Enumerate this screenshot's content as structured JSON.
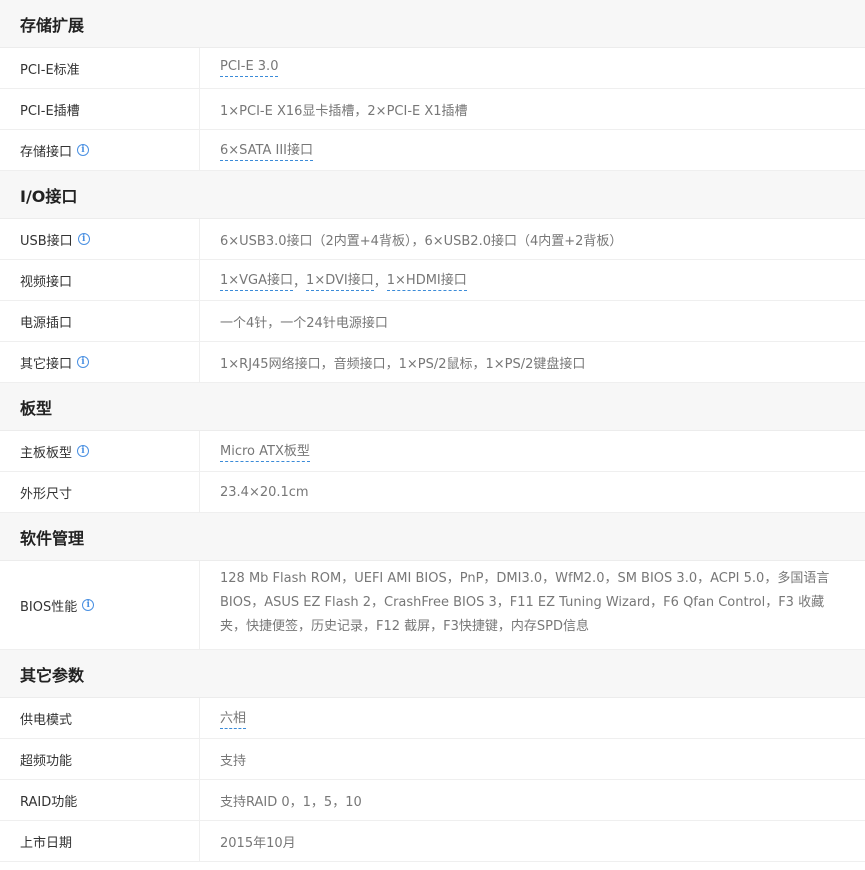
{
  "sections": [
    {
      "title": "存储扩展",
      "rows": [
        {
          "label": "PCI-E标准",
          "info": false,
          "links": [
            "PCI-E 3.0"
          ],
          "value": ""
        },
        {
          "label": "PCI-E插槽",
          "info": false,
          "value": "1×PCI-E X16显卡插槽，2×PCI-E X1插槽"
        },
        {
          "label": "存储接口",
          "info": true,
          "links": [
            "6×SATA III接口"
          ],
          "value": ""
        }
      ]
    },
    {
      "title": "I/O接口",
      "rows": [
        {
          "label": "USB接口",
          "info": true,
          "value": "6×USB3.0接口（2内置+4背板），6×USB2.0接口（4内置+2背板）"
        },
        {
          "label": "视频接口",
          "info": false,
          "links": [
            "1×VGA接口",
            "1×DVI接口",
            "1×HDMI接口"
          ],
          "value": ""
        },
        {
          "label": "电源插口",
          "info": false,
          "value": "一个4针，一个24针电源接口"
        },
        {
          "label": "其它接口",
          "info": true,
          "value": "1×RJ45网络接口，音频接口，1×PS/2鼠标，1×PS/2键盘接口"
        }
      ]
    },
    {
      "title": "板型",
      "rows": [
        {
          "label": "主板板型",
          "info": true,
          "links": [
            "Micro ATX板型"
          ],
          "value": ""
        },
        {
          "label": "外形尺寸",
          "info": false,
          "value": "23.4×20.1cm"
        }
      ]
    },
    {
      "title": "软件管理",
      "rows": [
        {
          "label": "BIOS性能",
          "info": true,
          "multi": true,
          "value": "128 Mb Flash ROM，UEFI AMI BIOS，PnP，DMI3.0，WfM2.0，SM BIOS 3.0，ACPI 5.0，多国语言BIOS，ASUS EZ Flash 2，CrashFree BIOS 3，F11 EZ Tuning Wizard，F6 Qfan Control，F3 收藏夹，快捷便签，历史记录，F12 截屏，F3快捷键，内存SPD信息"
        }
      ]
    },
    {
      "title": "其它参数",
      "rows": [
        {
          "label": "供电模式",
          "info": false,
          "links": [
            "六相"
          ],
          "value": ""
        },
        {
          "label": "超频功能",
          "info": false,
          "value": "支持"
        },
        {
          "label": "RAID功能",
          "info": false,
          "value": "支持RAID 0，1，5，10"
        },
        {
          "label": "上市日期",
          "info": false,
          "value": "2015年10月"
        }
      ]
    }
  ],
  "info_icon_glyph": "i",
  "link_separator": "，"
}
